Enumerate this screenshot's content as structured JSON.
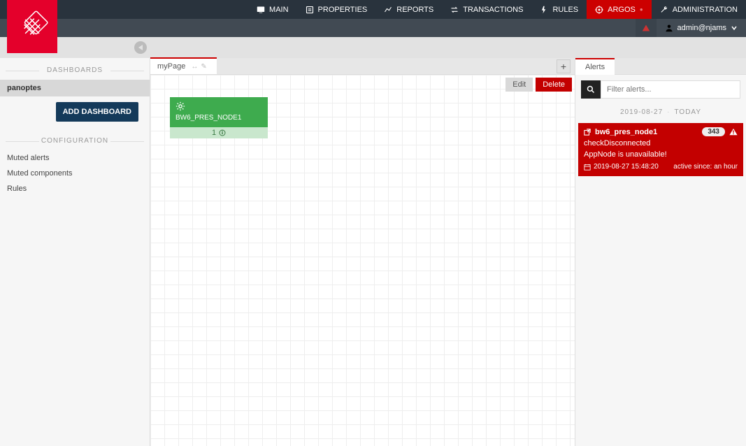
{
  "nav": {
    "items": [
      {
        "label": "MAIN",
        "icon": "monitor"
      },
      {
        "label": "PROPERTIES",
        "icon": "list"
      },
      {
        "label": "REPORTS",
        "icon": "chart"
      },
      {
        "label": "TRANSACTIONS",
        "icon": "swap"
      },
      {
        "label": "RULES",
        "icon": "bolt"
      },
      {
        "label": "ARGOS",
        "icon": "target",
        "active": true
      },
      {
        "label": "ADMINISTRATION",
        "icon": "wrench"
      }
    ]
  },
  "user": {
    "name": "admin@njams"
  },
  "sidebar": {
    "dash_title": "DASHBOARDS",
    "items": [
      {
        "label": "panoptes",
        "active": true
      }
    ],
    "add_label": "ADD DASHBOARD",
    "config_title": "CONFIGURATION",
    "config_items": [
      {
        "label": "Muted alerts"
      },
      {
        "label": "Muted components"
      },
      {
        "label": "Rules"
      }
    ]
  },
  "tabs": {
    "current": "myPage",
    "plus": "+"
  },
  "edit_row": {
    "edit": "Edit",
    "delete": "Delete"
  },
  "widget": {
    "title": "BW6_PRES_NODE1",
    "count": "1"
  },
  "alerts": {
    "tab": "Alerts",
    "filter_placeholder": "Filter alerts...",
    "date": "2019-08-27",
    "today": "TODAY",
    "card": {
      "title": "bw6_pres_node1",
      "count": "343",
      "check": "checkDisconnected",
      "message": "AppNode is unavailable!",
      "timestamp": "2019-08-27 15:48:20",
      "since": "active since: an hour"
    }
  }
}
